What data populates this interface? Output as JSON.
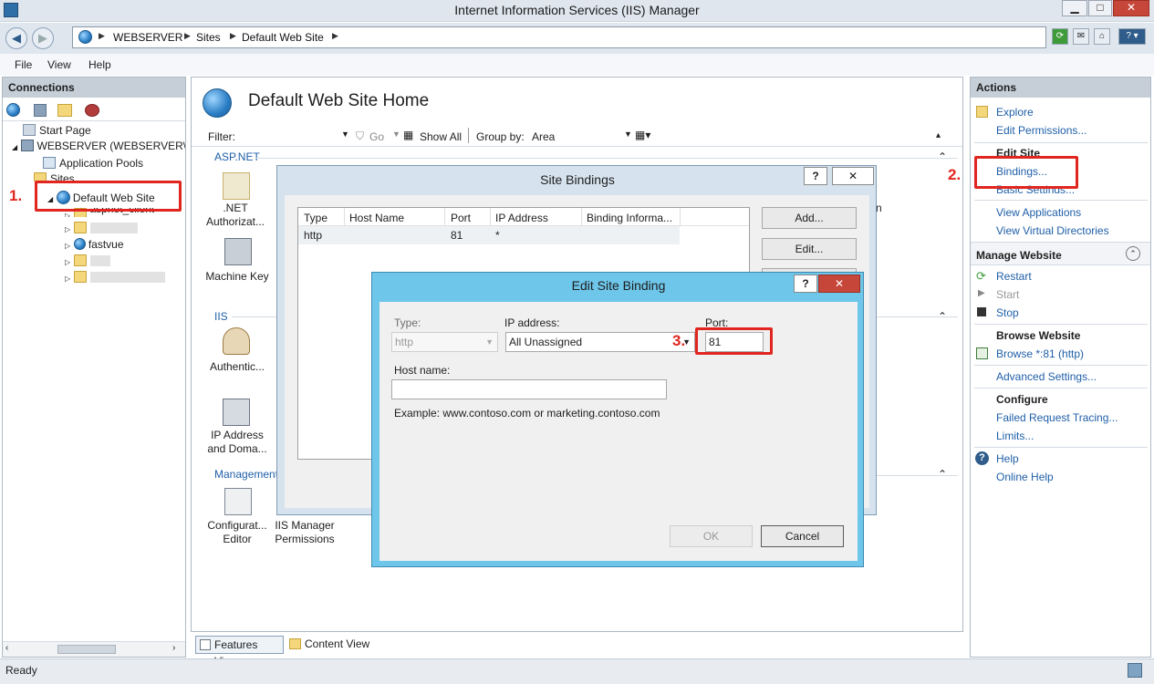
{
  "window": {
    "title": "Internet Information Services (IIS) Manager"
  },
  "address": {
    "crumbs": [
      "WEBSERVER",
      "Sites",
      "Default Web Site"
    ]
  },
  "menu": [
    "File",
    "View",
    "Help"
  ],
  "connections": {
    "header": "Connections",
    "tree": {
      "start_page": "Start Page",
      "server": "WEBSERVER (WEBSERVER\\Sco",
      "app_pools": "Application Pools",
      "sites": "Sites",
      "default_site": "Default Web Site",
      "aspnet_client": "aspnet_client",
      "fastvue": "fastvue"
    }
  },
  "center": {
    "title": "Default Web Site Home",
    "filter_label": "Filter:",
    "go": "Go",
    "show_all": "Show All",
    "group_by": "Group by:",
    "group_value": "Area",
    "sections": {
      "aspnet": "ASP.NET",
      "iis": "IIS",
      "management": "Management"
    },
    "features": {
      "net_auth": ".NET\nAuthorizat...",
      "machine_key": "Machine Key",
      "authentication": "Authentic...",
      "ip_address": "IP Address\nand Doma...",
      "config_editor": "Configurat...\nEditor",
      "iis_perm": "IIS Manager\nPermissions"
    },
    "clipped_char": "n",
    "view_tabs": {
      "features": "Features View",
      "content": "Content View"
    }
  },
  "actions": {
    "header": "Actions",
    "explore": "Explore",
    "edit_permissions": "Edit Permissions...",
    "edit_site": "Edit Site",
    "bindings": "Bindings...",
    "basic_settings": "Basic Settings...",
    "view_apps": "View Applications",
    "view_vdirs": "View Virtual Directories",
    "manage_website": "Manage Website",
    "restart": "Restart",
    "start": "Start",
    "stop": "Stop",
    "browse_website": "Browse Website",
    "browse_81": "Browse *:81 (http)",
    "advanced": "Advanced Settings...",
    "configure": "Configure",
    "failed_tracing": "Failed Request Tracing...",
    "limits": "Limits...",
    "help": "Help",
    "online_help": "Online Help"
  },
  "site_bindings": {
    "title": "Site Bindings",
    "columns": [
      "Type",
      "Host Name",
      "Port",
      "IP Address",
      "Binding Informa..."
    ],
    "rows": [
      {
        "type": "http",
        "host": "",
        "port": "81",
        "ip": "*",
        "info": ""
      }
    ],
    "add": "Add...",
    "edit": "Edit..."
  },
  "edit_binding": {
    "title": "Edit Site Binding",
    "type_label": "Type:",
    "type_value": "http",
    "ip_label": "IP address:",
    "ip_value": "All Unassigned",
    "port_label": "Port:",
    "port_value": "81",
    "host_label": "Host name:",
    "host_value": "",
    "example": "Example: www.contoso.com or marketing.contoso.com",
    "ok": "OK",
    "cancel": "Cancel"
  },
  "annotations": {
    "step1": "1.",
    "step2": "2.",
    "step3": "3."
  },
  "status": {
    "text": "Ready"
  },
  "colors": {
    "highlight": "#e0261f",
    "link": "#1f5fa8",
    "dialog_frame": "#6ec6ea"
  }
}
